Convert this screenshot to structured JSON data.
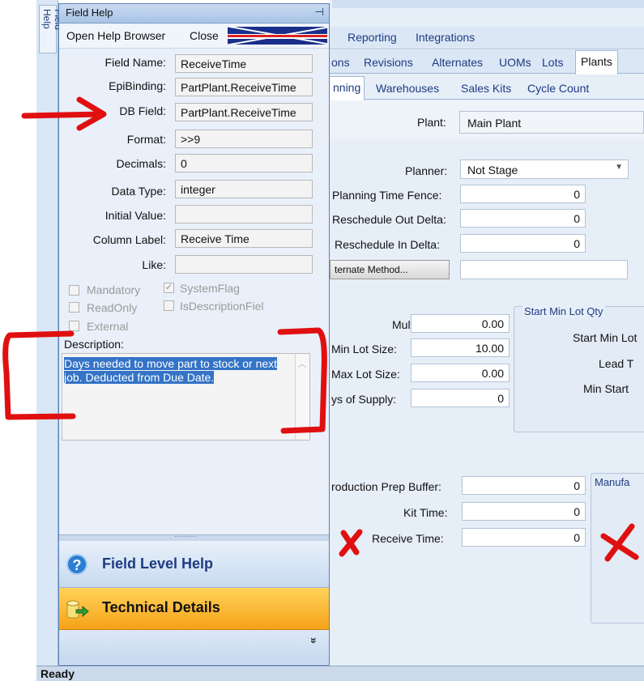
{
  "dock_tab": {
    "label": "Field Help"
  },
  "panel": {
    "title": "Field Help",
    "pin_glyph": "⊣",
    "menu": {
      "open_help_browser": "Open Help Browser",
      "close": "Close"
    },
    "fields": [
      {
        "label": "Field Name:",
        "value": "ReceiveTime"
      },
      {
        "label": "EpiBinding:",
        "value": "PartPlant.ReceiveTime"
      },
      {
        "label": "DB Field:",
        "value": "PartPlant.ReceiveTime"
      },
      {
        "label": "Format:",
        "value": ">>9"
      },
      {
        "label": "Decimals:",
        "value": "0"
      },
      {
        "label": "Data Type:",
        "value": "integer"
      },
      {
        "label": "Initial Value:",
        "value": ""
      },
      {
        "label": "Column Label:",
        "value": "Receive Time"
      },
      {
        "label": "Like:",
        "value": ""
      }
    ],
    "checkboxes": {
      "mandatory": "Mandatory",
      "system_flag": "SystemFlag",
      "read_only": "ReadOnly",
      "is_description": "IsDescriptionFiel",
      "external": "External"
    },
    "description_label": "Description:",
    "description_text": "Days needed to move part to stock or next job.  Deducted from Due Date.",
    "splitter_dots": "..........",
    "field_level_help": "Field Level Help",
    "technical_details": "Technical Details",
    "expand_glyph": "»"
  },
  "app": {
    "top_tabs": [
      "Reporting",
      "Integrations"
    ],
    "tabs_row2": [
      "ons",
      "Revisions",
      "Alternates",
      "UOMs",
      "Lots",
      "Plants"
    ],
    "tabs_row3": [
      "nning",
      "Warehouses",
      "Sales Kits",
      "Cycle Count"
    ],
    "plant": {
      "label": "Plant:",
      "value": "Main Plant"
    },
    "planner": {
      "label": "Planner:",
      "value": "Not Stage"
    },
    "planning_fields": [
      {
        "label": "Planning Time Fence:",
        "value": "0"
      },
      {
        "label": "Reschedule Out Delta:",
        "value": "0"
      },
      {
        "label": "Reschedule In Delta:",
        "value": "0"
      }
    ],
    "alternate_method_button": "ternate Method...",
    "lot_fields": [
      {
        "label": "Multiple:",
        "value": "0.00"
      },
      {
        "label": "Min Lot Size:",
        "value": "10.00"
      },
      {
        "label": "Max Lot Size:",
        "value": "0.00"
      },
      {
        "label": "ys of Supply:",
        "value": "0"
      }
    ],
    "start_min_group": {
      "title": "Start Min Lot Qty",
      "l1": "Start Min Lot",
      "l2": "Lead T",
      "l3": "Min Start"
    },
    "prod_fields": [
      {
        "label": "roduction Prep Buffer:",
        "value": "0"
      },
      {
        "label": "Kit Time:",
        "value": "0"
      },
      {
        "label": "Receive Time:",
        "value": "0"
      }
    ],
    "manufa_group_title": "Manufa"
  },
  "status": {
    "text": "Ready"
  },
  "colors": {
    "annotation": "#e01010",
    "highlight": "#3473c6",
    "tech_orange": "#f6a218"
  }
}
